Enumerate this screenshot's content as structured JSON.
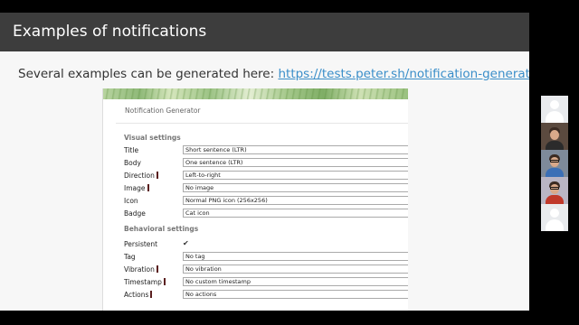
{
  "slide": {
    "title": "Examples of notifications",
    "subtitle_prefix": "Several examples can be generated here: ",
    "link_text": "https://tests.peter.sh/notification-generator/"
  },
  "generator": {
    "title": "Notification Generator",
    "visual_section": "Visual settings",
    "behavioral_section": "Behavioral settings",
    "rows": {
      "title": {
        "label": "Title",
        "value": "Short sentence (LTR)"
      },
      "body": {
        "label": "Body",
        "value": "One sentence (LTR)"
      },
      "direction": {
        "label": "Direction",
        "value": "Left-to-right"
      },
      "image": {
        "label": "Image",
        "value": "No image"
      },
      "icon": {
        "label": "Icon",
        "value": "Normal PNG icon (256x256)"
      },
      "badge": {
        "label": "Badge",
        "value": "Cat icon"
      },
      "persistent": {
        "label": "Persistent",
        "checked": true,
        "check_glyph": "✔"
      },
      "tag": {
        "label": "Tag",
        "value": "No tag"
      },
      "vibration": {
        "label": "Vibration",
        "value": "No vibration"
      },
      "timestamp": {
        "label": "Timestamp",
        "value": "No custom timestamp"
      },
      "actions": {
        "label": "Actions",
        "value": "No actions"
      }
    }
  },
  "participants": [
    {
      "kind": "placeholder"
    },
    {
      "kind": "video",
      "shirt_color": "#2b2b2b",
      "bg_color": "#5b4a3f"
    },
    {
      "kind": "video",
      "shirt_color": "#3b6fb6",
      "bg_color": "#7e8a9a"
    },
    {
      "kind": "video",
      "shirt_color": "#c0392b",
      "bg_color": "#b9b5c4"
    },
    {
      "kind": "placeholder"
    }
  ],
  "colors": {
    "header_bg": "#3d3d3d",
    "link": "#3a8ec9",
    "marker": "#5a1f1f"
  }
}
